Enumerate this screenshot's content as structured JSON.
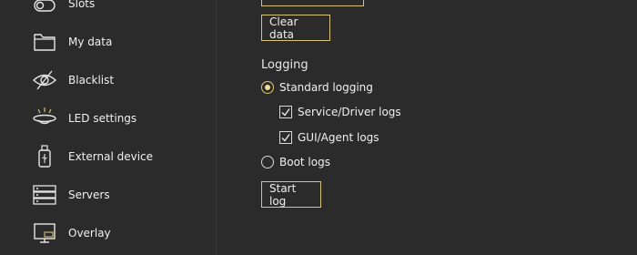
{
  "sidebar": {
    "items": [
      {
        "label": "Slots",
        "icon": "toggle-icon"
      },
      {
        "label": "My data",
        "icon": "folder-icon"
      },
      {
        "label": "Blacklist",
        "icon": "eye-off-icon"
      },
      {
        "label": "LED settings",
        "icon": "led-icon"
      },
      {
        "label": "External device",
        "icon": "usb-device-icon"
      },
      {
        "label": "Servers",
        "icon": "server-icon"
      },
      {
        "label": "Overlay",
        "icon": "monitor-icon"
      }
    ]
  },
  "main": {
    "clear_data_label": "Clear data",
    "logging": {
      "title": "Logging",
      "standard_logging": "Standard logging",
      "service_driver_logs": "Service/Driver logs",
      "gui_agent_logs": "GUI/Agent logs",
      "boot_logs": "Boot logs",
      "start_log_label": "Start log"
    }
  },
  "colors": {
    "accent": "#d9c27a",
    "background": "#2b2b2b",
    "text": "#f0f0f0"
  }
}
